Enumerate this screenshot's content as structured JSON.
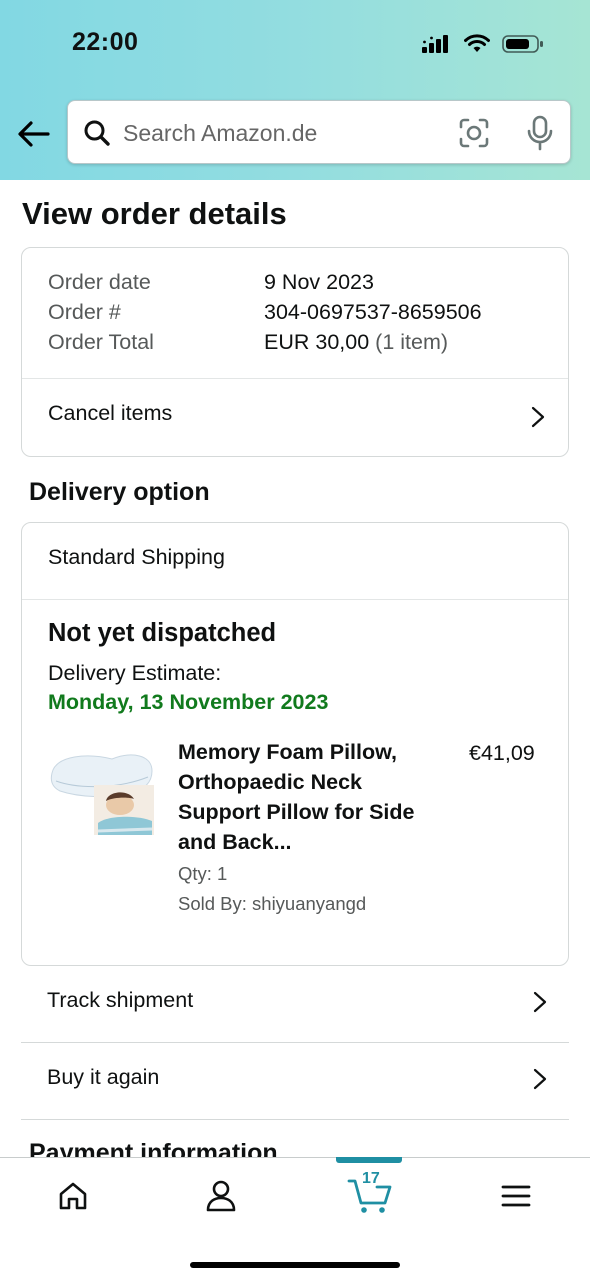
{
  "status_bar": {
    "time": "22:00"
  },
  "search": {
    "placeholder": "Search Amazon.de"
  },
  "page": {
    "title": "View order details"
  },
  "order": {
    "date_label": "Order date",
    "date_value": "9 Nov 2023",
    "number_label": "Order #",
    "number_value": "304-0697537-8659506",
    "total_label": "Order Total",
    "total_value": "EUR 30,00",
    "total_items": "(1 item)",
    "cancel_label": "Cancel items"
  },
  "delivery": {
    "section_title": "Delivery option",
    "shipping_type": "Standard Shipping",
    "status": "Not yet dispatched",
    "estimate_label": "Delivery Estimate:",
    "estimate_date": "Monday, 13 November 2023",
    "estimate_color": "#117a1d",
    "product": {
      "title": "Memory Foam Pillow, Orthopaedic Neck Support Pillow for Side and Back...",
      "price": "€41,09",
      "qty": "Qty: 1",
      "seller": "Sold By: shiyuanyangd"
    }
  },
  "actions": {
    "track_label": "Track shipment",
    "buy_again_label": "Buy it again"
  },
  "payment": {
    "section_title": "Payment information"
  },
  "bottom_nav": {
    "cart_count": "17",
    "accent_color": "#1f8fa3",
    "items": [
      "home-icon",
      "account-icon",
      "cart-icon",
      "menu-icon"
    ]
  }
}
